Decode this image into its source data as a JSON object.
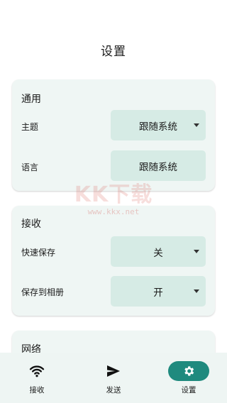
{
  "page": {
    "title": "设置"
  },
  "sections": {
    "general": {
      "title": "通用",
      "theme_label": "主题",
      "theme_value": "跟随系统",
      "language_label": "语言",
      "language_value": "跟随系统"
    },
    "receive": {
      "title": "接收",
      "quick_save_label": "快速保存",
      "quick_save_value": "关",
      "save_to_album_label": "保存到相册",
      "save_to_album_value": "开"
    },
    "network": {
      "title": "网络"
    }
  },
  "watermark": {
    "big": "KK下载",
    "small": "www.kkx.net"
  },
  "bottom_nav": {
    "items": [
      {
        "label": "接收",
        "icon": "wifi-icon"
      },
      {
        "label": "发送",
        "icon": "send-icon"
      },
      {
        "label": "设置",
        "icon": "gear-icon",
        "active": true
      }
    ]
  },
  "colors": {
    "card_bg": "#eff6f4",
    "select_bg": "#d6ebe5",
    "accent": "#1f8a7e",
    "nav_bg": "#eef5f3"
  }
}
